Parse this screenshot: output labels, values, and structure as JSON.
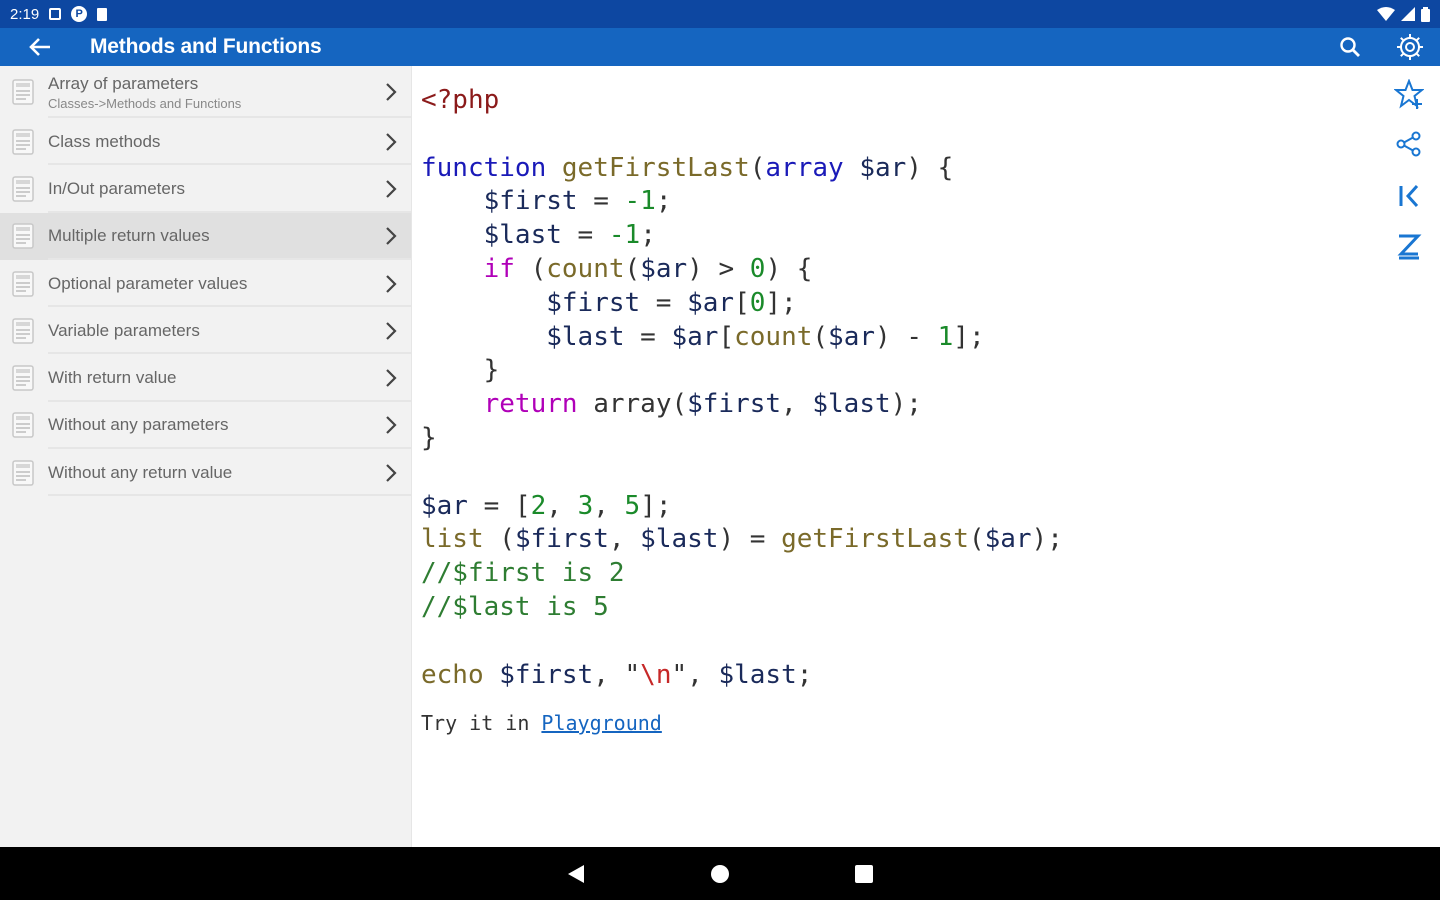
{
  "status_bar": {
    "time": "2:19",
    "notif_icons": [
      "square-notification-icon",
      "p-app-icon",
      "sd-card-icon"
    ],
    "system_icons": [
      "wifi-icon",
      "signal-icon",
      "battery-icon"
    ]
  },
  "app_bar": {
    "title": "Methods and Functions",
    "back_icon": "arrow-left-icon",
    "actions": [
      "search-icon",
      "gear-icon"
    ]
  },
  "sidebar": {
    "items": [
      {
        "label": "Array of parameters",
        "subtitle": "Classes->Methods and Functions",
        "selected": false
      },
      {
        "label": "Class methods",
        "subtitle": "",
        "selected": false
      },
      {
        "label": "In/Out parameters",
        "subtitle": "",
        "selected": false
      },
      {
        "label": "Multiple return values",
        "subtitle": "",
        "selected": true
      },
      {
        "label": "Optional parameter values",
        "subtitle": "",
        "selected": false
      },
      {
        "label": "Variable parameters",
        "subtitle": "",
        "selected": false
      },
      {
        "label": "With return value",
        "subtitle": "",
        "selected": false
      },
      {
        "label": "Without any parameters",
        "subtitle": "",
        "selected": false
      },
      {
        "label": "Without any return value",
        "subtitle": "",
        "selected": false
      }
    ]
  },
  "code": {
    "lines": [
      "<?php",
      "",
      "function getFirstLast(array $ar) {",
      "    $first = -1;",
      "    $last = -1;",
      "    if (count($ar) > 0) {",
      "        $first = $ar[0];",
      "        $last = $ar[count($ar) - 1];",
      "    }",
      "    return array($first, $last);",
      "}",
      "",
      "$ar = [2, 3, 5];",
      "list ($first, $last) = getFirstLast($ar);",
      "//$first is 2",
      "//$last is 5",
      "",
      "echo $first, \"\\n\", $last;"
    ],
    "try_prefix": "Try it in ",
    "try_link": "Playground"
  },
  "right_rail": [
    "star-plus-icon",
    "share-icon",
    "first-page-icon",
    "sigma-z-icon"
  ],
  "nav_bar": [
    "back-triangle-icon",
    "home-circle-icon",
    "recents-square-icon"
  ],
  "colors": {
    "status_bar": "#0d47a1",
    "app_bar": "#1565c0",
    "accent": "#1565c0",
    "selected_row": "#e0e0e0"
  }
}
